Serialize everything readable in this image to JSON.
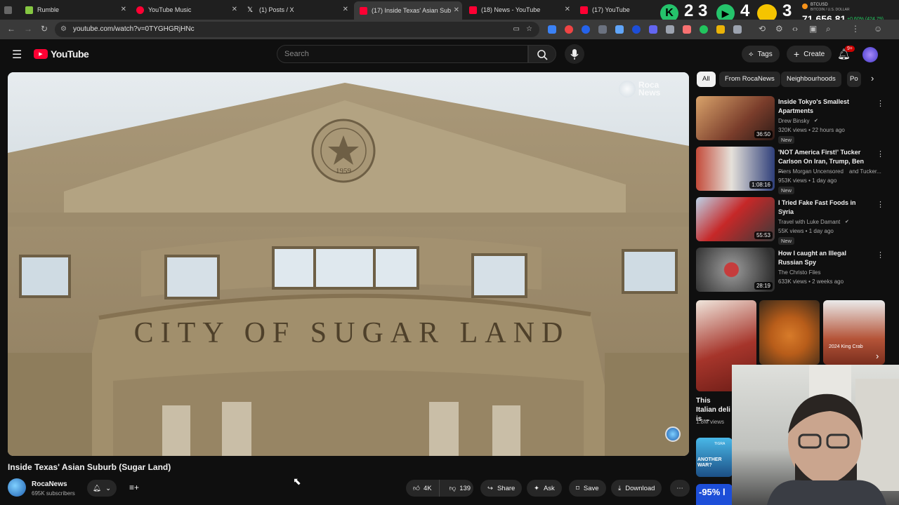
{
  "browser": {
    "tabs": [
      {
        "label": "Rumble"
      },
      {
        "label": "YouTube Music"
      },
      {
        "label": "(1) Posts / X"
      },
      {
        "label": "(17) Inside Texas' Asian Sub"
      },
      {
        "label": "(18) News - YouTube"
      },
      {
        "label": "(17) YouTube"
      }
    ],
    "url": "youtube.com/watch?v=0TYGHGRjHNc",
    "ticker": {
      "symbol": "BTCUSD",
      "sub": "BITCOIN / U.S. DOLLAR",
      "price": "71,656.81",
      "change": "+0.60% (424.79)"
    },
    "counters": [
      "2",
      "3",
      "4",
      "3"
    ]
  },
  "yt": {
    "logo": "YouTube",
    "search_placeholder": "Search",
    "tags_label": "Tags",
    "create_label": "Create",
    "notif_badge": "9+"
  },
  "video": {
    "title": "Inside Texas' Asian Suburb (Sugar Land)",
    "sign_text": "CITY OF SUGAR LAND",
    "seal_year": "1959",
    "channel": "RocaNews",
    "subscribers": "695K subscribers",
    "likes": "4K",
    "dislikes": "139",
    "share": "Share",
    "ask": "Ask",
    "save": "Save",
    "download": "Download",
    "watermark": "Roca News"
  },
  "chips": [
    "All",
    "From RocaNews",
    "Neighbourhoods",
    "Po"
  ],
  "recs": [
    {
      "title": "Inside Tokyo's Smallest Apartments",
      "channel": "Drew Binsky",
      "meta": "320K views • 22 hours ago",
      "duration": "36:50",
      "badge": "New"
    },
    {
      "title": "'NOT America First!' Tucker Carlson On Iran, Trump, Ben ...",
      "channel": "Piers Morgan Uncensored",
      "channel_extra": "and Tucker...",
      "meta": "953K views • 1 day ago",
      "duration": "1:08:16",
      "badge": "New"
    },
    {
      "title": "I Tried Fake Fast Foods in Syria",
      "title2": "SY",
      "channel": "Travel with Luke Damant",
      "meta": "55K views • 1 day ago",
      "duration": "55:53",
      "badge": "New"
    },
    {
      "title": "How I caught an Illegal Russian Spy",
      "channel": "The Christo Files",
      "meta": "633K views • 2 weeks ago",
      "duration": "28:19",
      "badge": ""
    }
  ],
  "shorts": {
    "caption": "2024 King Crab",
    "bottom_title": "This Italian deli is ...",
    "bottom_views": "1.8M views",
    "next_tag": "ANOTHER WAR?",
    "next_tag2": "TIGRA",
    "promo": "-95% l"
  }
}
